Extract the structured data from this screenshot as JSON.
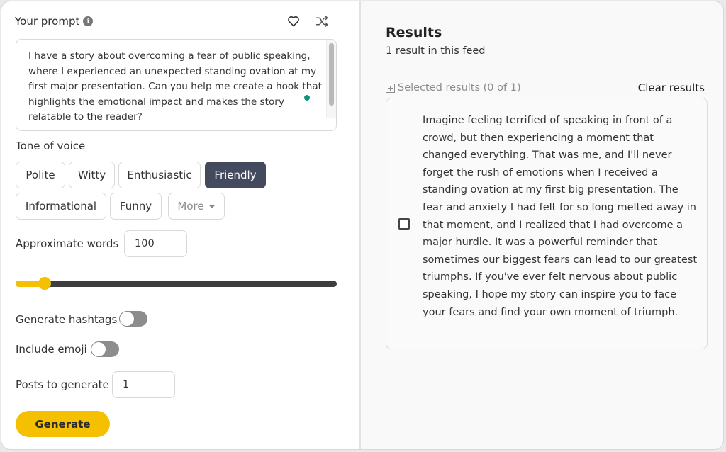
{
  "prompt": {
    "label": "Your prompt",
    "info_icon": "info-icon",
    "favorite_icon": "heart-icon",
    "shuffle_icon": "shuffle-icon",
    "text": "I have a story about overcoming a fear of public speaking, where I experienced an unexpected standing ovation at my first major presentation. Can you help me create a hook that highlights the emotional impact and makes the story relatable to the reader?"
  },
  "tone": {
    "label": "Tone of voice",
    "options": [
      "Polite",
      "Witty",
      "Enthusiastic",
      "Friendly",
      "Informational",
      "Funny"
    ],
    "selected": "Friendly",
    "more_label": "More"
  },
  "words": {
    "label": "Approximate words",
    "value": "100",
    "slider_fraction": 0.09
  },
  "hashtags": {
    "label": "Generate hashtags",
    "enabled": false
  },
  "emoji": {
    "label": "Include emoji",
    "enabled": false
  },
  "posts": {
    "label": "Posts to generate",
    "value": "1"
  },
  "generate_label": "Generate",
  "results": {
    "title": "Results",
    "subtitle": "1 result in this feed",
    "selected_label": "Selected results (0 of 1)",
    "clear_label": "Clear results",
    "items": [
      {
        "checked": false,
        "text": "Imagine feeling terrified of speaking in front of a crowd, but then experiencing a moment that changed everything. That was me, and I'll never forget the rush of emotions when I received a standing ovation at my first big presentation. The fear and anxiety I had felt for so long melted away in that moment, and I realized that I had overcome a major hurdle. It was a powerful reminder that sometimes our biggest fears can lead to our greatest triumphs. If you've ever felt nervous about public speaking, I hope my story can inspire you to face your fears and find your own moment of triumph."
      }
    ]
  },
  "colors": {
    "accent": "#f5c000",
    "selected_chip": "#434a5e",
    "status_dot": "#11917a"
  }
}
